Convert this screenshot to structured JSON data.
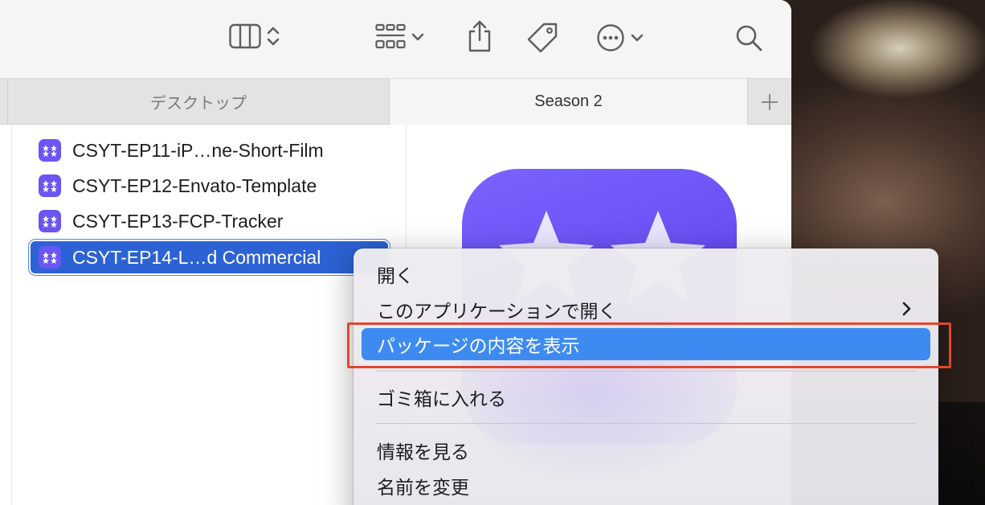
{
  "tabs": [
    {
      "label": "デスクトップ",
      "active": false
    },
    {
      "label": "Season 2",
      "active": true
    }
  ],
  "files": [
    {
      "name": "CSYT-EP11-iP…ne-Short-Film",
      "selected": false
    },
    {
      "name": "CSYT-EP12-Envato-Template",
      "selected": false
    },
    {
      "name": "CSYT-EP13-FCP-Tracker",
      "selected": false
    },
    {
      "name": "CSYT-EP14-L…d Commercial",
      "selected": true
    }
  ],
  "context_menu": {
    "items": [
      {
        "label": "開く"
      },
      {
        "label": "このアプリケーションで開く",
        "submenu": true
      },
      {
        "label": "パッケージの内容を表示",
        "highlighted": true
      },
      {
        "label": "ゴミ箱に入れる"
      },
      {
        "label": "情報を見る"
      },
      {
        "label": "名前を変更"
      }
    ]
  },
  "colors": {
    "selection": "#2c62d3",
    "menu_highlight": "#3d8bf0",
    "annotation": "#e2462f",
    "app_icon": "#6a56f4"
  }
}
